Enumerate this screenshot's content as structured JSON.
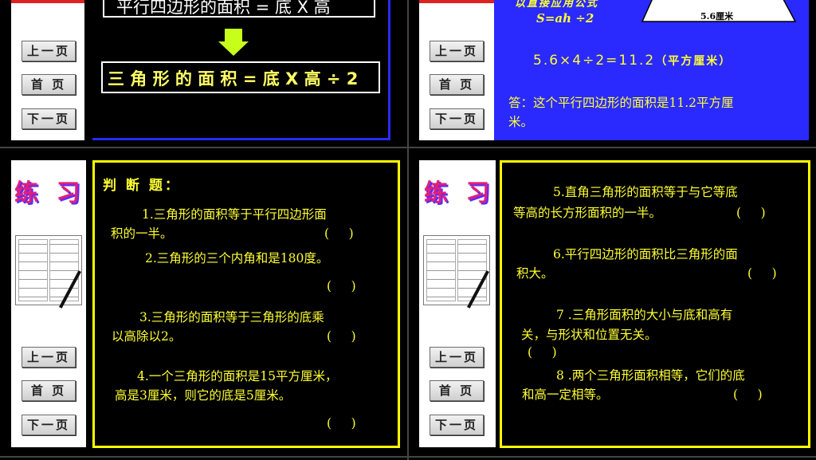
{
  "nav": {
    "prev": "上一页",
    "home": "首 页",
    "next": "下一页"
  },
  "slide_formula": {
    "line1": "平行四边形的面积 = 底 X 高",
    "line2": "三 角 形 的 面 积 = 底 X 高 ÷ 2"
  },
  "slide_answer": {
    "note": "以直接应用公式",
    "formula": "S=ah ÷2",
    "dim_label": "5.6厘米",
    "calc": "5.6×4÷2=11.2",
    "calc_unit": "（平方厘米）",
    "answer_line1": "答：这个平行四边形的面积是11.2平方厘",
    "answer_line2": "米。"
  },
  "practice_logo": "练 习",
  "quiz1": {
    "title": "判 断 题：",
    "q1_a": "1.三角形的面积等于平行四边形面",
    "q1_b": "积的一半。",
    "q2": "2.三角形的三个内角和是180度。",
    "q3_a": "3.三角形的面积等于三角形的底乘",
    "q3_b": "以高除以2。",
    "q4_a": "4.一个三角形的面积是15平方厘米，",
    "q4_b": "高是3厘米，则它的底是5厘米。",
    "paren": "(     )"
  },
  "quiz2": {
    "q5_a": "5.直角三角形的面积等于与它等底",
    "q5_b": "等高的长方形面积的一半。",
    "q6_a": "6.平行四边形的面积比三角形的面",
    "q6_b": "积大。",
    "q7_a": "7 .三角形面积的大小与底和高有",
    "q7_b": "关，与形状和位置无关。",
    "q8_a": "8 .两个三角形面积相等，它们的底",
    "q8_b": "和高一定相等。",
    "paren": "(     )"
  },
  "colors": {
    "panel_blue": "#2a2aff",
    "accent_yellow": "#ffff33",
    "border_yellow": "#ffff00"
  }
}
